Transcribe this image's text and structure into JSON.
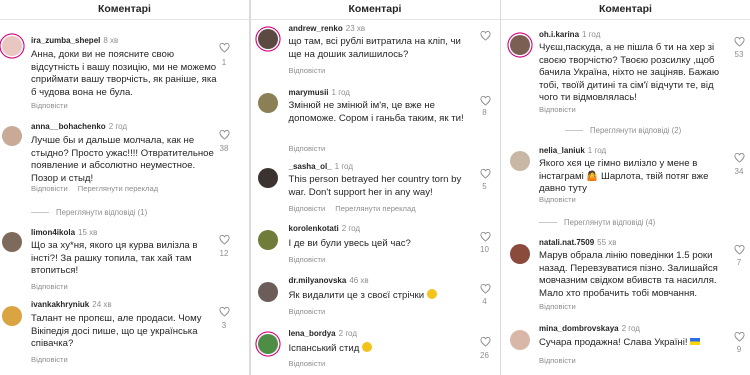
{
  "panels": [
    {
      "header": "Коментарі",
      "comments": [
        {
          "user": "ira_zumba_shepel",
          "time": "8 хв",
          "text": "Анна, доки ви не поясните свою відсутність і вашу позицію, ми не можемо сприймати вашу творчість, як раніше, яка б чудова вона не була.",
          "reply": "Відповісти",
          "likes": "1"
        },
        {
          "user": "anna__bohachenko",
          "time": "2 год",
          "text": "Лучше бы и дальше молчала, как не стыдно? Просто ужас!!!! Отвратительное появление и абсолютно неуместное. Позор и стыд!",
          "reply": "Відповісти",
          "translate": "Переглянути переклад",
          "likes": "38",
          "view_replies": "Переглянути відповіді (1)"
        },
        {
          "user": "limon4ikola",
          "time": "15 хв",
          "text": "Що за ху*ня, якого ця курва вилізла в інсті?! За рашку топила, так хай там втопиться!",
          "reply": "Відповісти",
          "likes": "12"
        },
        {
          "user": "ivankakhryniuk",
          "time": "24 хв",
          "text": "Талант не пропєш, але продаси. Чому Вікіпедія досі пише, що це українська співачка?",
          "reply": "Відповісти",
          "likes": "3"
        }
      ]
    },
    {
      "header": "Коментарі",
      "comments": [
        {
          "user": "andrew_renko",
          "time": "23 хв",
          "text": "що там, всі рублі витратила на кліп, чи ще на дошик залишилось?",
          "reply": "Відповісти",
          "likes": ""
        },
        {
          "user": "marymusii",
          "time": "1 год",
          "text": "Змінюй не змінюй ім'я, це вже не допоможе. Сором і ганьба таким, як ти!",
          "reply": "Відповісти",
          "likes": "8"
        },
        {
          "user": "_sasha_ol_",
          "time": "1 год",
          "text": "This person betrayed her country torn by war. Don't support her in any way!",
          "reply": "Відповісти",
          "translate": "Переглянути переклад",
          "likes": "5"
        },
        {
          "user": "korolenkotati",
          "time": "2 год",
          "text": "І де ви були увесь цей час?",
          "reply": "Відповісти",
          "likes": "10"
        },
        {
          "user": "dr.milyanovska",
          "time": "46 хв",
          "text": "Як видалити це з своєї стрічки",
          "reply": "Відповісти",
          "likes": "4"
        },
        {
          "user": "lena_bordya",
          "time": "2 год",
          "text": "Іспанський стид",
          "reply": "Відповісти",
          "likes": "26"
        }
      ]
    },
    {
      "header": "Коментарі",
      "comments": [
        {
          "user": "oh.i.karina",
          "time": "1 год",
          "text": "Чуєш,паскуда, а не пішла б ти на хер зі своєю творчістю? Твоєю розсилку ,щоб бачила Україна, ніхто не заціняв. Бажаю тобі, твоїй дитині та сім'ї відчути те, від чого ти відмовлялась!",
          "reply": "Відповісти",
          "likes": "53",
          "view_replies": "Переглянути відповіді (2)"
        },
        {
          "user": "nelia_laniuk",
          "time": "1 год",
          "text": "Якого хєя це гімно вилізло у мене в інстаграмі 🤷 Шарлота, твій потяг вже давно туту",
          "reply": "Відповісти",
          "likes": "34",
          "view_replies": "Переглянути відповіді (4)"
        },
        {
          "user": "natali.nat.7509",
          "time": "55 хв",
          "text": "Марув обрала лінію поведінки 1.5 роки назад. Перевзуватися пізно. Залишайся мовчазним свідком вбивств та насилля. Мало хто пробачить тобі мовчання.",
          "reply": "Відповісти",
          "likes": "7"
        },
        {
          "user": "mina_dombrovskaya",
          "time": "2 год",
          "text": "Сучара продажна! Слава Україні!",
          "reply": "Відповісти",
          "likes": "9"
        }
      ]
    }
  ],
  "icons": {
    "like": "heart-outline-icon",
    "emoji": "emoji-icon",
    "flag": "ukraine-flag-icon"
  },
  "colors": {
    "muted": "#8e8e8e",
    "text": "#262626",
    "story_ring": "#d3007a"
  }
}
